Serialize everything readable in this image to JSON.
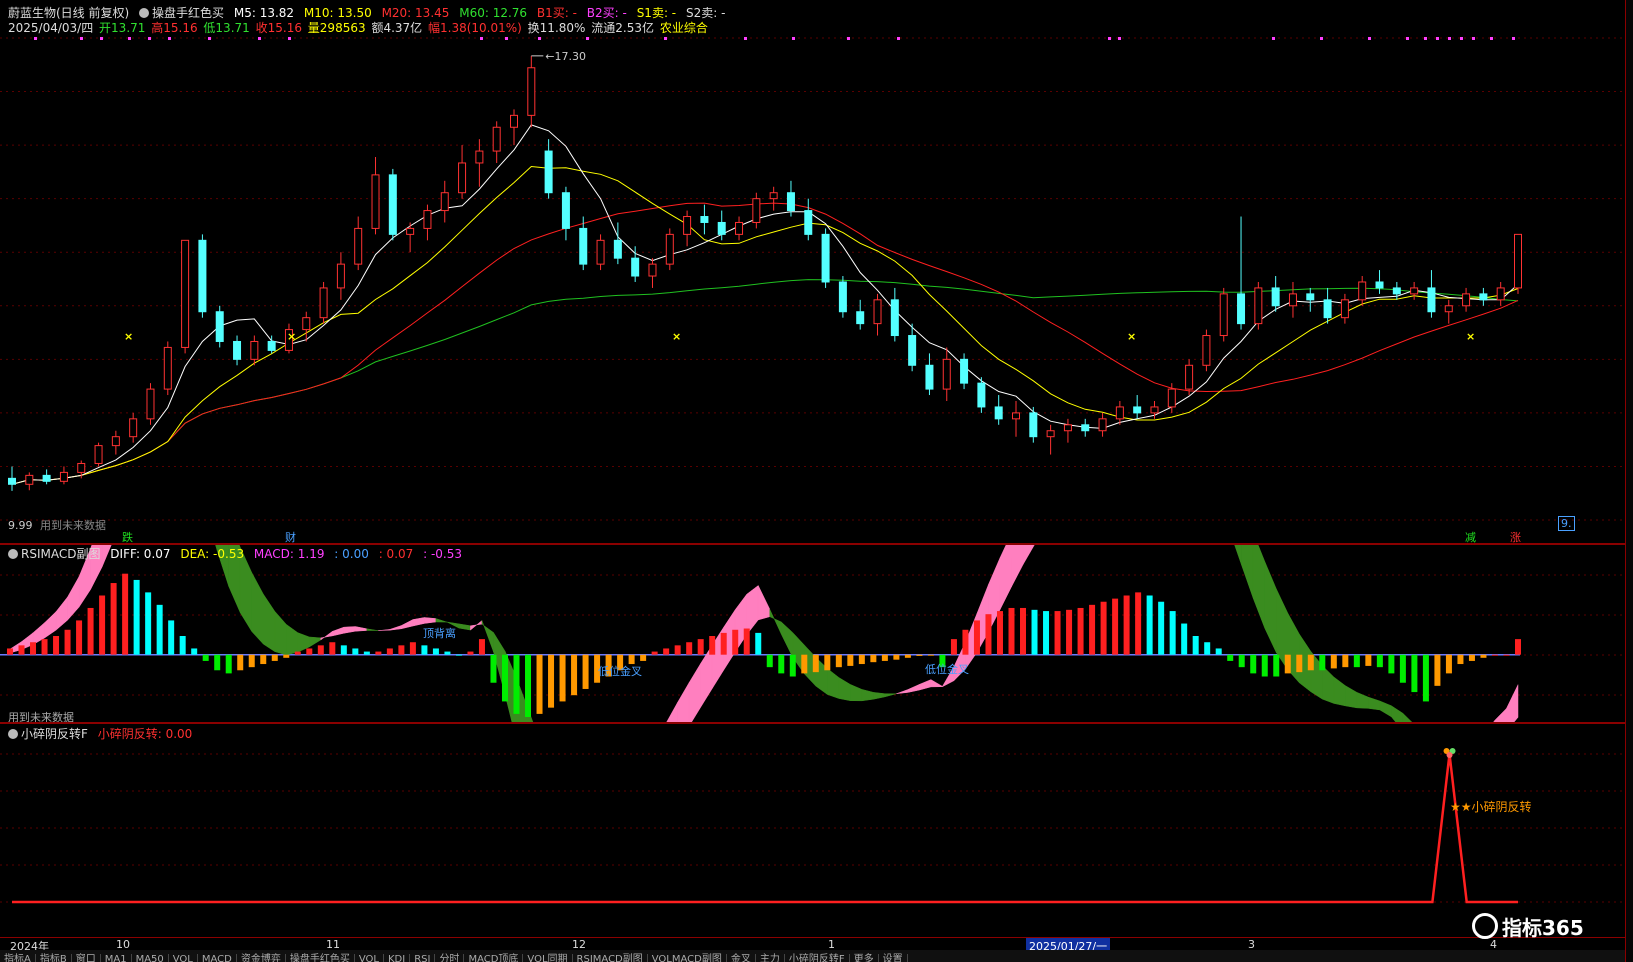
{
  "main": {
    "info1": {
      "title": "蔚蓝生物(日线 前复权)",
      "indicator": "操盘手红色买",
      "m5": "M5: 13.82",
      "m10": "M10: 13.50",
      "m20": "M20: 13.45",
      "m60": "M60: 12.76",
      "b1": "B1买: -",
      "b2": "B2买: -",
      "s1": "S1卖: -",
      "s2": "S2卖: -"
    },
    "info2": {
      "date": "2025/04/03/四",
      "open": "开13.71",
      "high": "高15.16",
      "low": "低13.71",
      "close": "收15.16",
      "vol": "量298563",
      "amount": "额4.37亿",
      "change": "幅1.38(10.01%)",
      "turnover": "换11.80%",
      "float": "流通2.53亿",
      "sector": "农业综合"
    },
    "peak_label": "17.30",
    "low_label": "9.99",
    "future_label": "用到未来数据",
    "badges": [
      "跌",
      "财",
      "减",
      "涨"
    ],
    "right_edge": "9."
  },
  "sub1": {
    "title": "RSIMACD副图",
    "diff": "DIFF: 0.07",
    "dea": "DEA: -0.53",
    "macd": "MACD: 1.19",
    "v1": ": 0.00",
    "v2": ": 0.07",
    "v3": ": -0.53",
    "future_label": "用到未来数据",
    "annotations": [
      "顶背离",
      "低位金叉",
      "低位金叉"
    ]
  },
  "sub2": {
    "title": "小碎阴反转F",
    "value": "小碎阴反转: 0.00",
    "signal_label": "★★小碎阴反转"
  },
  "xaxis": {
    "labels": [
      "2024年",
      "10",
      "11",
      "12",
      "1",
      "2025/01/27/一",
      "3",
      "4"
    ]
  },
  "taskbar": {
    "items": [
      "指标A",
      "指标B",
      "窗口",
      "MA1",
      "MA50",
      "VOL",
      "MACD",
      "资金博弈",
      "操盘手红色买",
      "VOL",
      "KDJ",
      "RSI",
      "分时",
      "MACD顶底",
      "VOL同期",
      "RSIMACD副图",
      "VOLMACD副图",
      "金叉",
      "主力",
      "小碎阴反转F",
      "更多",
      "设置"
    ]
  },
  "brand": "指标365",
  "colors": {
    "up": "#ff3232",
    "down": "#54ffff",
    "ma5": "#ffffff",
    "ma10": "#ffff00",
    "ma20": "#ff2020",
    "ma60": "#20c020",
    "diff": "#ff7fbf",
    "dea": "#3a8c1f",
    "macd_pos_strong": "#ff2020",
    "macd_pos_weak": "#00ffff",
    "macd_neg_strong": "#00ee00",
    "macd_neg_weak": "#ff9900"
  },
  "chart_data": [
    {
      "type": "candlestick",
      "title": "蔚蓝生物(日线 前复权)",
      "ylim": [
        9.5,
        17.6
      ],
      "ohlc": [
        [
          10.2,
          10.4,
          9.99,
          10.1
        ],
        [
          10.1,
          10.3,
          10.0,
          10.25
        ],
        [
          10.25,
          10.35,
          10.1,
          10.15
        ],
        [
          10.15,
          10.4,
          10.1,
          10.3
        ],
        [
          10.3,
          10.5,
          10.2,
          10.45
        ],
        [
          10.45,
          10.8,
          10.4,
          10.75
        ],
        [
          10.75,
          11.0,
          10.6,
          10.9
        ],
        [
          10.9,
          11.3,
          10.8,
          11.2
        ],
        [
          11.2,
          11.8,
          11.1,
          11.7
        ],
        [
          11.7,
          12.5,
          11.6,
          12.4
        ],
        [
          12.4,
          14.2,
          12.3,
          14.2
        ],
        [
          14.2,
          14.3,
          12.9,
          13.0
        ],
        [
          13.0,
          13.1,
          12.4,
          12.5
        ],
        [
          12.5,
          12.6,
          12.1,
          12.2
        ],
        [
          12.2,
          12.6,
          12.1,
          12.5
        ],
        [
          12.5,
          12.6,
          12.3,
          12.35
        ],
        [
          12.35,
          12.8,
          12.3,
          12.7
        ],
        [
          12.7,
          13.0,
          12.5,
          12.9
        ],
        [
          12.9,
          13.5,
          12.8,
          13.4
        ],
        [
          13.4,
          14.0,
          13.2,
          13.8
        ],
        [
          13.8,
          14.6,
          13.7,
          14.4
        ],
        [
          14.4,
          15.6,
          14.3,
          15.3
        ],
        [
          15.3,
          15.4,
          14.2,
          14.3
        ],
        [
          14.3,
          14.5,
          14.0,
          14.4
        ],
        [
          14.4,
          14.8,
          14.2,
          14.7
        ],
        [
          14.7,
          15.2,
          14.5,
          15.0
        ],
        [
          15.0,
          15.8,
          14.9,
          15.5
        ],
        [
          15.5,
          15.9,
          15.1,
          15.7
        ],
        [
          15.7,
          16.2,
          15.5,
          16.1
        ],
        [
          16.1,
          16.4,
          15.8,
          16.3
        ],
        [
          16.3,
          17.3,
          16.1,
          17.1
        ],
        [
          15.7,
          15.9,
          14.9,
          15.0
        ],
        [
          15.0,
          15.1,
          14.2,
          14.4
        ],
        [
          14.4,
          14.6,
          13.7,
          13.8
        ],
        [
          13.8,
          14.3,
          13.7,
          14.2
        ],
        [
          14.2,
          14.5,
          13.8,
          13.9
        ],
        [
          13.9,
          14.1,
          13.5,
          13.6
        ],
        [
          13.6,
          13.9,
          13.4,
          13.8
        ],
        [
          13.8,
          14.4,
          13.7,
          14.3
        ],
        [
          14.3,
          14.7,
          14.1,
          14.6
        ],
        [
          14.6,
          14.8,
          14.3,
          14.5
        ],
        [
          14.5,
          14.7,
          14.2,
          14.3
        ],
        [
          14.3,
          14.6,
          14.2,
          14.5
        ],
        [
          14.5,
          15.0,
          14.4,
          14.9
        ],
        [
          14.9,
          15.1,
          14.7,
          15.0
        ],
        [
          15.0,
          15.2,
          14.6,
          14.7
        ],
        [
          14.7,
          14.9,
          14.2,
          14.3
        ],
        [
          14.3,
          14.4,
          13.4,
          13.5
        ],
        [
          13.5,
          13.6,
          12.9,
          13.0
        ],
        [
          13.0,
          13.2,
          12.7,
          12.8
        ],
        [
          12.8,
          13.3,
          12.6,
          13.2
        ],
        [
          13.2,
          13.4,
          12.5,
          12.6
        ],
        [
          12.6,
          12.8,
          12.0,
          12.1
        ],
        [
          12.1,
          12.3,
          11.6,
          11.7
        ],
        [
          11.7,
          12.4,
          11.5,
          12.2
        ],
        [
          12.2,
          12.3,
          11.7,
          11.8
        ],
        [
          11.8,
          11.9,
          11.3,
          11.4
        ],
        [
          11.4,
          11.6,
          11.1,
          11.2
        ],
        [
          11.2,
          11.5,
          10.9,
          11.3
        ],
        [
          11.3,
          11.4,
          10.8,
          10.9
        ],
        [
          10.9,
          11.1,
          10.6,
          11.0
        ],
        [
          11.0,
          11.2,
          10.8,
          11.1
        ],
        [
          11.1,
          11.2,
          10.9,
          11.0
        ],
        [
          11.0,
          11.3,
          10.9,
          11.2
        ],
        [
          11.2,
          11.5,
          11.1,
          11.4
        ],
        [
          11.4,
          11.6,
          11.2,
          11.3
        ],
        [
          11.3,
          11.5,
          11.2,
          11.4
        ],
        [
          11.4,
          11.8,
          11.3,
          11.7
        ],
        [
          11.7,
          12.2,
          11.6,
          12.1
        ],
        [
          12.1,
          12.7,
          12.0,
          12.6
        ],
        [
          12.6,
          13.4,
          12.5,
          13.3
        ],
        [
          13.3,
          14.6,
          12.7,
          12.8
        ],
        [
          12.8,
          13.5,
          12.7,
          13.4
        ],
        [
          13.4,
          13.6,
          13.0,
          13.1
        ],
        [
          13.1,
          13.5,
          12.9,
          13.3
        ],
        [
          13.3,
          13.4,
          13.0,
          13.2
        ],
        [
          13.2,
          13.4,
          12.8,
          12.9
        ],
        [
          12.9,
          13.3,
          12.8,
          13.2
        ],
        [
          13.2,
          13.6,
          13.1,
          13.5
        ],
        [
          13.5,
          13.7,
          13.3,
          13.4
        ],
        [
          13.4,
          13.5,
          13.2,
          13.3
        ],
        [
          13.3,
          13.5,
          13.2,
          13.4
        ],
        [
          13.4,
          13.7,
          12.9,
          13.0
        ],
        [
          13.0,
          13.2,
          12.8,
          13.1
        ],
        [
          13.1,
          13.4,
          13.0,
          13.3
        ],
        [
          13.3,
          13.4,
          13.1,
          13.2
        ],
        [
          13.2,
          13.5,
          13.1,
          13.4
        ],
        [
          13.4,
          14.3,
          13.3,
          14.3
        ]
      ],
      "series": [
        {
          "name": "M5",
          "latest": 13.82
        },
        {
          "name": "M10",
          "latest": 13.5
        },
        {
          "name": "M20",
          "latest": 13.45
        },
        {
          "name": "M60",
          "latest": 12.76
        }
      ]
    },
    {
      "type": "bar",
      "title": "RSIMACD副图",
      "ylim": [
        -1.0,
        1.6
      ],
      "values": [
        0.1,
        0.15,
        0.2,
        0.25,
        0.3,
        0.4,
        0.55,
        0.75,
        0.95,
        1.15,
        1.3,
        1.2,
        1.0,
        0.8,
        0.55,
        0.3,
        0.1,
        -0.1,
        -0.25,
        -0.3,
        -0.25,
        -0.2,
        -0.15,
        -0.1,
        -0.05,
        0.05,
        0.1,
        0.15,
        0.2,
        0.15,
        0.1,
        0.05,
        0.05,
        0.1,
        0.15,
        0.2,
        0.15,
        0.1,
        0.05,
        0.0,
        0.05,
        0.25,
        -0.45,
        -0.75,
        -0.95,
        -1.0,
        -0.95,
        -0.85,
        -0.75,
        -0.65,
        -0.55,
        -0.45,
        -0.35,
        -0.25,
        -0.15,
        -0.1,
        0.05,
        0.1,
        0.15,
        0.2,
        0.25,
        0.3,
        0.35,
        0.4,
        0.42,
        0.35,
        -0.2,
        -0.3,
        -0.35,
        -0.3,
        -0.28,
        -0.25,
        -0.2,
        -0.18,
        -0.15,
        -0.12,
        -0.1,
        -0.08,
        -0.05,
        -0.02,
        -0.01,
        -0.2,
        0.25,
        0.4,
        0.55,
        0.65,
        0.7,
        0.75,
        0.75,
        0.72,
        0.7,
        0.7,
        0.72,
        0.75,
        0.8,
        0.85,
        0.9,
        0.95,
        1.0,
        0.95,
        0.85,
        0.7,
        0.5,
        0.3,
        0.2,
        0.1,
        -0.1,
        -0.2,
        -0.3,
        -0.35,
        -0.35,
        -0.3,
        -0.28,
        -0.25,
        -0.25,
        -0.22,
        -0.2,
        -0.2,
        -0.18,
        -0.2,
        -0.3,
        -0.45,
        -0.6,
        -0.75,
        -0.5,
        -0.3,
        -0.15,
        -0.1,
        -0.05,
        0.0,
        0.0,
        0.25
      ]
    },
    {
      "type": "line",
      "title": "小碎阴反转F",
      "ylim": [
        0,
        1
      ],
      "values": [
        0,
        0,
        0,
        0,
        0,
        0,
        0,
        0,
        0,
        0,
        0,
        0,
        0,
        0,
        0,
        0,
        0,
        0,
        0,
        0,
        0,
        0,
        0,
        0,
        0,
        0,
        0,
        0,
        0,
        0,
        0,
        0,
        0,
        0,
        0,
        0,
        0,
        0,
        0,
        0,
        0,
        0,
        0,
        0,
        0,
        0,
        0,
        0,
        0,
        0,
        0,
        0,
        0,
        0,
        0,
        0,
        0,
        0,
        0,
        0,
        0,
        0,
        0,
        0,
        0,
        0,
        0,
        0,
        0,
        0,
        0,
        0,
        0,
        0,
        0,
        0,
        0,
        0,
        0,
        0,
        0,
        0,
        0,
        0,
        1,
        0,
        0,
        0,
        0
      ]
    }
  ]
}
